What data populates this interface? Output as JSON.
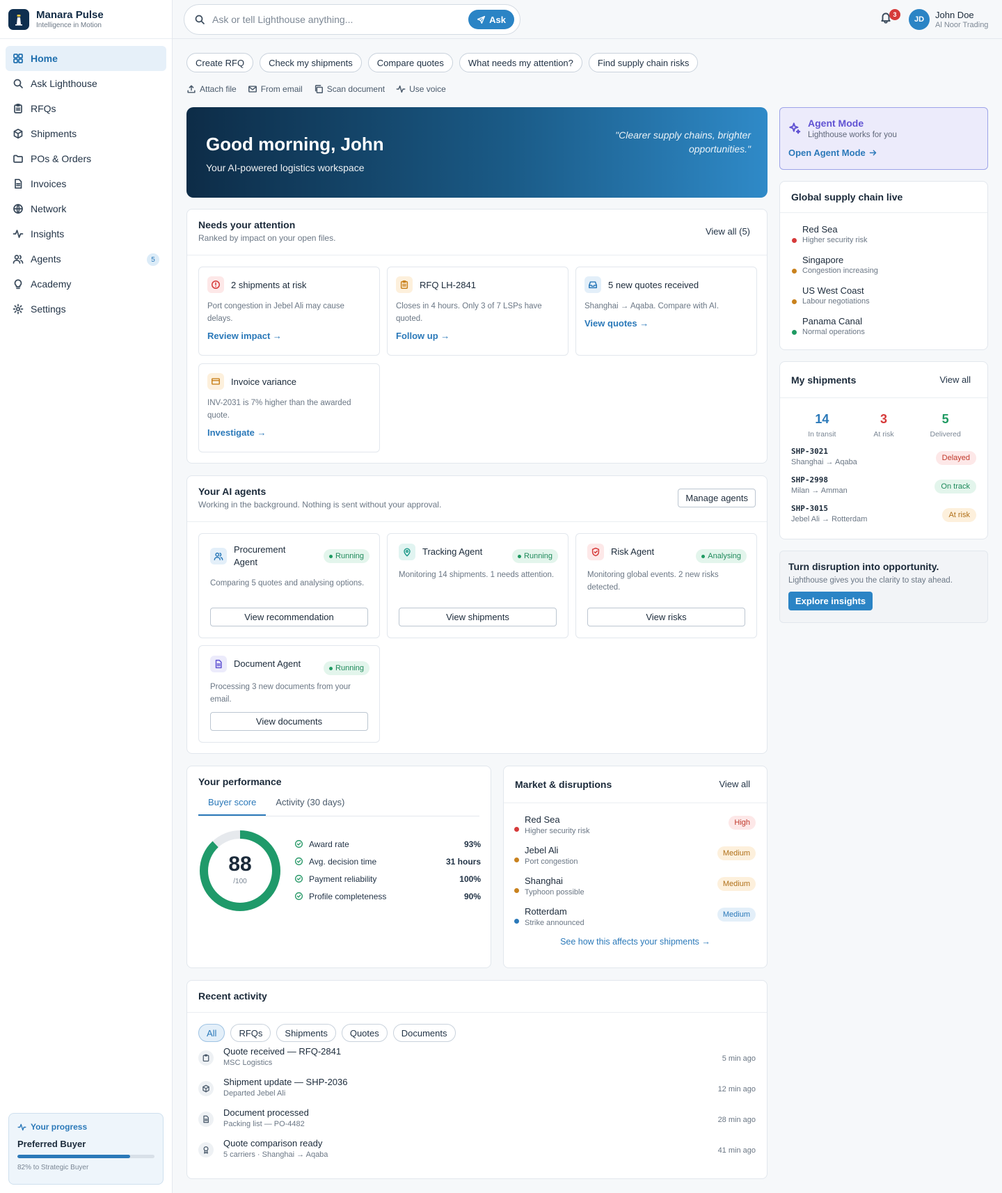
{
  "brand": {
    "name": "Manara Pulse",
    "tagline": "Intelligence in Motion"
  },
  "nav": [
    {
      "label": "Home",
      "icon": "grid-icon",
      "active": true
    },
    {
      "label": "Ask Lighthouse",
      "icon": "search-icon"
    },
    {
      "label": "RFQs",
      "icon": "clipboard-icon"
    },
    {
      "label": "Shipments",
      "icon": "box-icon"
    },
    {
      "label": "POs & Orders",
      "icon": "folder-icon"
    },
    {
      "label": "Invoices",
      "icon": "file-icon"
    },
    {
      "label": "Network",
      "icon": "globe-icon"
    },
    {
      "label": "Insights",
      "icon": "activity-icon"
    },
    {
      "label": "Agents",
      "icon": "users-icon",
      "badge": "5"
    },
    {
      "label": "Academy",
      "icon": "lightbulb-icon"
    },
    {
      "label": "Settings",
      "icon": "gear-icon"
    }
  ],
  "progress": {
    "title": "Your progress",
    "level": "Preferred Buyer",
    "percent": 82,
    "note": "82% to Strategic Buyer"
  },
  "search": {
    "placeholder": "Ask or tell Lighthouse anything...",
    "button": "Ask"
  },
  "notifications": {
    "count": "3"
  },
  "user": {
    "initials": "JD",
    "name": "John Doe",
    "org": "Al Noor Trading"
  },
  "quick_actions": [
    "Create RFQ",
    "Check my shipments",
    "Compare quotes",
    "What needs my attention?",
    "Find supply chain risks"
  ],
  "tools": [
    {
      "label": "Attach file",
      "icon": "upload-icon"
    },
    {
      "label": "From email",
      "icon": "mail-icon"
    },
    {
      "label": "Scan document",
      "icon": "copy-icon"
    },
    {
      "label": "Use voice",
      "icon": "waveform-icon"
    }
  ],
  "hero": {
    "title": "Good morning, John",
    "subtitle": "Your AI-powered logistics workspace",
    "quote": "\"Clearer supply chains, brighter opportunities.\""
  },
  "attention": {
    "title": "Needs your attention",
    "subtitle": "Ranked by impact on your open files.",
    "view_all": "View all (5)",
    "items": [
      {
        "title": "2 shipments at risk",
        "desc": "Port congestion in Jebel Ali may cause delays.",
        "link": "Review impact →",
        "icon": "alert-circle-icon",
        "color": "#d63a3a",
        "bg": "#fde8e8"
      },
      {
        "title": "RFQ LH-2841",
        "desc": "Closes in 4 hours. Only 3 of 7 LSPs have quoted.",
        "link": "Follow up →",
        "icon": "clipboard-icon",
        "color": "#c9821e",
        "bg": "#fdf0dc"
      },
      {
        "title": "5 new quotes received",
        "desc": "Shanghai → Aqaba. Compare with AI.",
        "link": "View quotes →",
        "icon": "inbox-icon",
        "color": "#2b79b9",
        "bg": "#e3eff9"
      },
      {
        "title": "Invoice variance",
        "desc": "INV-2031 is 7% higher than the awarded quote.",
        "link": "Investigate →",
        "icon": "card-icon",
        "color": "#c9821e",
        "bg": "#fdf0dc"
      }
    ]
  },
  "agents": {
    "title": "Your AI agents",
    "subtitle": "Working in the background. Nothing is sent without your approval.",
    "manage": "Manage agents",
    "items": [
      {
        "name": "Procurement Agent",
        "status": "Running",
        "desc": "Comparing 5 quotes and analysing options.",
        "button": "View recommendation",
        "icon": "users-icon",
        "color": "#2b79b9",
        "bg": "#e3eff9"
      },
      {
        "name": "Tracking Agent",
        "status": "Running",
        "desc": "Monitoring 14 shipments. 1 needs attention.",
        "button": "View shipments",
        "icon": "pin-icon",
        "color": "#1f9a8a",
        "bg": "#e1f4f1"
      },
      {
        "name": "Risk Agent",
        "status": "Analysing",
        "desc": "Monitoring global events. 2 new risks detected.",
        "button": "View risks",
        "icon": "shield-icon",
        "color": "#d63a3a",
        "bg": "#fde8e8"
      },
      {
        "name": "Document Agent",
        "status": "Running",
        "desc": "Processing 3 new documents from your email.",
        "button": "View documents",
        "icon": "file-icon",
        "color": "#6153d3",
        "bg": "#ecebfb"
      }
    ]
  },
  "performance": {
    "title": "Your performance",
    "tabs": [
      "Buyer score",
      "Activity (30 days)"
    ],
    "score": 88,
    "score_max": "/100",
    "metrics": [
      {
        "label": "Award rate",
        "value": "93%"
      },
      {
        "label": "Avg. decision time",
        "value": "31 hours"
      },
      {
        "label": "Payment reliability",
        "value": "100%"
      },
      {
        "label": "Profile completeness",
        "value": "90%"
      }
    ]
  },
  "market": {
    "title": "Market & disruptions",
    "view_all": "View all",
    "items": [
      {
        "name": "Red Sea",
        "desc": "Higher security risk",
        "severity": "High",
        "dot": "#d63a3a",
        "sev_bg": "#fde8e8",
        "sev_fg": "#c0392b"
      },
      {
        "name": "Jebel Ali",
        "desc": "Port congestion",
        "severity": "Medium",
        "dot": "#c9821e",
        "sev_bg": "#fdf0dc",
        "sev_fg": "#b0701a"
      },
      {
        "name": "Shanghai",
        "desc": "Typhoon possible",
        "severity": "Medium",
        "dot": "#c9821e",
        "sev_bg": "#fdf0dc",
        "sev_fg": "#b0701a"
      },
      {
        "name": "Rotterdam",
        "desc": "Strike announced",
        "severity": "Medium",
        "dot": "#2b79b9",
        "sev_bg": "#e3eff9",
        "sev_fg": "#2b79b9"
      }
    ],
    "footer": "See how this affects your shipments →"
  },
  "activity": {
    "title": "Recent activity",
    "filters": [
      "All",
      "RFQs",
      "Shipments",
      "Quotes",
      "Documents"
    ],
    "items": [
      {
        "title": "Quote received — RFQ-2841",
        "desc": "MSC Logistics",
        "time": "5 min ago",
        "icon": "clipboard-icon"
      },
      {
        "title": "Shipment update — SHP-2036",
        "desc": "Departed Jebel Ali",
        "time": "12 min ago",
        "icon": "box-icon"
      },
      {
        "title": "Document processed",
        "desc": "Packing list — PO-4482",
        "time": "28 min ago",
        "icon": "file-icon"
      },
      {
        "title": "Quote comparison ready",
        "desc": "5 carriers · Shanghai → Aqaba",
        "time": "41 min ago",
        "icon": "award-icon"
      }
    ]
  },
  "agent_mode": {
    "title": "Agent Mode",
    "subtitle": "Lighthouse works for you",
    "link": "Open Agent Mode"
  },
  "global": {
    "title": "Global supply chain live",
    "items": [
      {
        "name": "Red Sea",
        "desc": "Higher security risk",
        "dot": "#d63a3a"
      },
      {
        "name": "Singapore",
        "desc": "Congestion increasing",
        "dot": "#c9821e"
      },
      {
        "name": "US West Coast",
        "desc": "Labour negotiations",
        "dot": "#c9821e"
      },
      {
        "name": "Panama Canal",
        "desc": "Normal operations",
        "dot": "#1f9a62"
      }
    ]
  },
  "my_shipments": {
    "title": "My shipments",
    "view_all": "View all",
    "stats": [
      {
        "value": "14",
        "label": "In transit",
        "color": "#2b79b9"
      },
      {
        "value": "3",
        "label": "At risk",
        "color": "#d63a3a"
      },
      {
        "value": "5",
        "label": "Delivered",
        "color": "#1f9a62"
      }
    ],
    "items": [
      {
        "id": "SHP-3021",
        "route": "Shanghai → Aqaba",
        "status": "Delayed",
        "bg": "#fde8e8",
        "fg": "#c0392b"
      },
      {
        "id": "SHP-2998",
        "route": "Milan → Amman",
        "status": "On track",
        "bg": "#e3f5ec",
        "fg": "#1f8a5b"
      },
      {
        "id": "SHP-3015",
        "route": "Jebel Ali → Rotterdam",
        "status": "At risk",
        "bg": "#fdf0dc",
        "fg": "#b0701a"
      }
    ]
  },
  "promo": {
    "title": "Turn disruption into opportunity.",
    "subtitle": "Lighthouse gives you the clarity to stay ahead.",
    "button": "Explore insights"
  }
}
